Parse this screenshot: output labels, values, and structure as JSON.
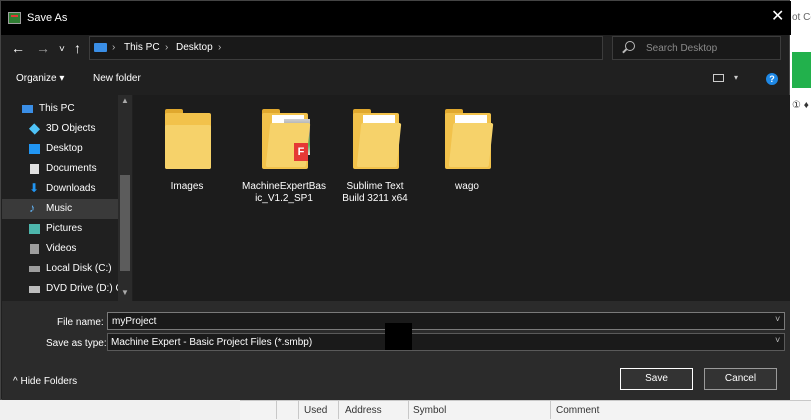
{
  "window": {
    "title": "Save As",
    "close_glyph": "✕"
  },
  "nav": {
    "back_glyph": "←",
    "forward_glyph": "→",
    "recent_glyph": "˅",
    "up_glyph": "↑",
    "breadcrumbs": [
      "This PC",
      "Desktop"
    ],
    "crumb_sep": "›",
    "dropdown_glyph": "˅",
    "refresh_glyph": "↻",
    "search_placeholder": "Search Desktop"
  },
  "toolbar": {
    "organize": "Organize ▾",
    "new_folder": "New folder",
    "help": "?",
    "view_drop": "▾"
  },
  "tree": [
    {
      "label": "This PC",
      "icon": "computer-icon"
    },
    {
      "label": "3D Objects",
      "icon": "cube-icon"
    },
    {
      "label": "Desktop",
      "icon": "desktop-icon"
    },
    {
      "label": "Documents",
      "icon": "document-icon"
    },
    {
      "label": "Downloads",
      "icon": "download-icon"
    },
    {
      "label": "Music",
      "icon": "music-icon",
      "selected": true
    },
    {
      "label": "Pictures",
      "icon": "picture-icon"
    },
    {
      "label": "Videos",
      "icon": "video-icon"
    },
    {
      "label": "Local Disk (C:)",
      "icon": "disk-icon"
    },
    {
      "label": "DVD Drive (D:) C",
      "icon": "dvd-icon"
    }
  ],
  "scroll": {
    "up_glyph": "▲",
    "down_glyph": "▼"
  },
  "files": [
    {
      "label": "Images",
      "icon": "folder-icon"
    },
    {
      "label": "MachineExpertBasic_V1.2_SP1",
      "icon": "folder-icon",
      "badge": "F"
    },
    {
      "label": "Sublime Text Build 3211 x64",
      "icon": "folder-icon"
    },
    {
      "label": "wago",
      "icon": "folder-icon"
    }
  ],
  "form": {
    "file_name_label": "File name:",
    "file_name_value": "myProject",
    "save_type_label": "Save as type:",
    "save_type_value": "Machine Expert - Basic Project Files (*.smbp)",
    "chevron": "˅",
    "hide_folders": "^  Hide Folders",
    "save": "Save",
    "cancel": "Cancel"
  },
  "background_app": {
    "tab_text": "ot Co",
    "toolbar_text": "① ♦",
    "columns": [
      "Used",
      "Address",
      "Symbol",
      "Comment"
    ]
  },
  "colors": {
    "accent": "#1e88e5",
    "folder": "#f2c24b",
    "dialog_bg": "#202020"
  }
}
